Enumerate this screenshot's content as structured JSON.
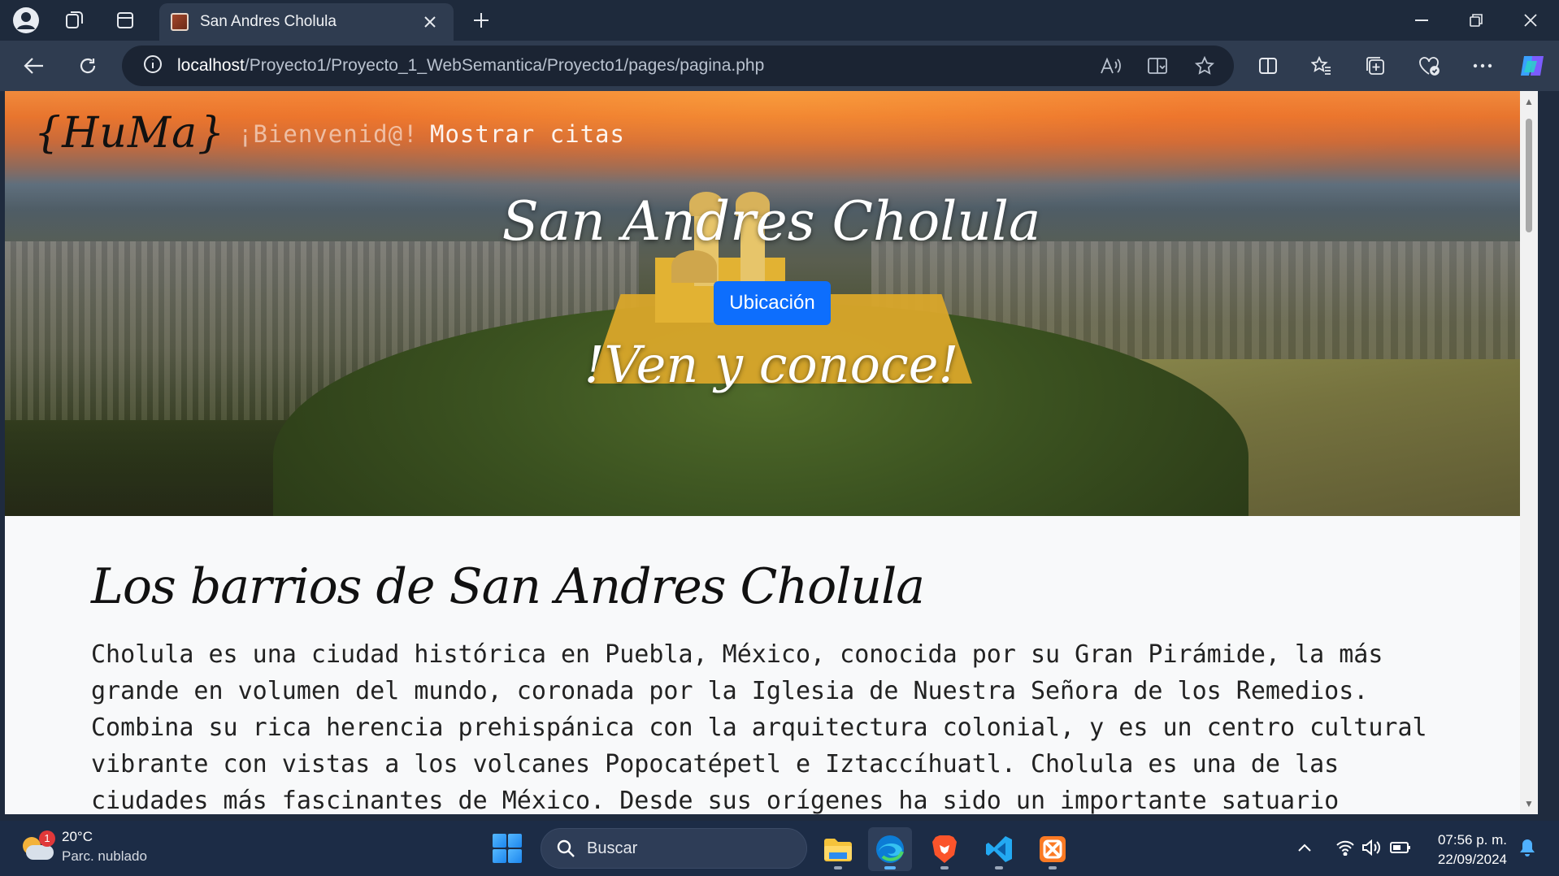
{
  "browser": {
    "tab_title": "San Andres Cholula",
    "url_host": "localhost",
    "url_path": "/Proyecto1/Proyecto_1_WebSemantica/Proyecto1/pages/pagina.php"
  },
  "page": {
    "brand": "{HuMa}",
    "nav": {
      "welcome": "¡Bienvenid@!",
      "appointments": "Mostrar citas"
    },
    "hero": {
      "title": "San Andres Cholula",
      "button": "Ubicación",
      "subtitle": "!Ven y conoce!"
    },
    "section": {
      "heading": "Los barrios de San Andres Cholula",
      "paragraph": "Cholula es una ciudad histórica en Puebla, México, conocida por su Gran Pirámide, la más grande en volumen del mundo, coronada por la Iglesia de Nuestra Señora de los Remedios. Combina su rica herencia prehispánica con la arquitectura colonial, y es un centro cultural vibrante con vistas a los volcanes Popocatépetl e Iztaccíhuatl. Cholula es una de las ciudades más fascinantes de México. Desde sus orígenes ha sido un importante satuario"
    }
  },
  "taskbar": {
    "weather_temp": "20°C",
    "weather_condition": "Parc. nublado",
    "weather_badge": "1",
    "search_placeholder": "Buscar",
    "time": "07:56 p. m.",
    "date": "22/09/2024"
  },
  "colors": {
    "accent": "#0d6efd",
    "titlebar": "#1e2a3c",
    "toolbar": "#2f3c50",
    "taskbar": "#1c2c46"
  }
}
